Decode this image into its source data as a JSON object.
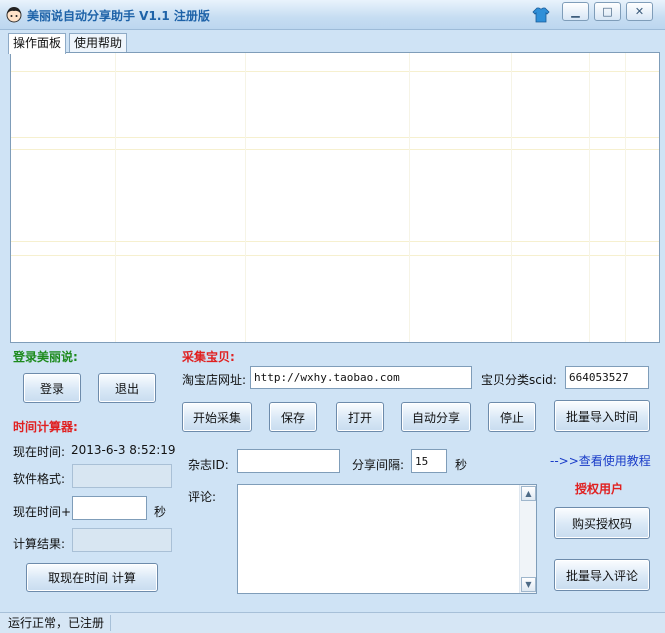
{
  "window": {
    "title": "美丽说自动分享助手 V1.1 注册版",
    "minimize_icon": "minimize-icon",
    "maximize_icon": "maximize-icon",
    "close_icon": "close-icon"
  },
  "tabs": [
    {
      "label": "操作面板"
    },
    {
      "label": "使用帮助"
    }
  ],
  "login": {
    "heading": "登录美丽说:",
    "login_button": "登录",
    "logout_button": "退出"
  },
  "collect": {
    "heading": "采集宝贝:",
    "shop_url_label": "淘宝店网址:",
    "shop_url_value": "http://wxhy.taobao.com",
    "scid_label": "宝贝分类scid:",
    "scid_value": "664053527",
    "buttons": {
      "start": "开始采集",
      "save": "保存",
      "open": "打开",
      "auto_share": "自动分享",
      "stop": "停止",
      "batch_time": "批量导入时间"
    }
  },
  "timer": {
    "heading": "时间计算器:",
    "now_label": "现在时间:",
    "now_value": "2013-6-3 8:52:19",
    "format_label": "软件格式:",
    "now_plus_label": "现在时间+",
    "seconds_unit": "秒",
    "result_label": "计算结果:",
    "calc_button": "取现在时间 计算"
  },
  "share": {
    "magazine_label": "杂志ID:",
    "magazine_value": "",
    "interval_label": "分享间隔:",
    "interval_value": "15",
    "interval_unit": "秒",
    "comment_label": "评论:",
    "tutorial_link": "-->>查看使用教程",
    "authorized_text": "授权用户",
    "buy_button": "购买授权码",
    "batch_comment_button": "批量导入评论"
  },
  "status": {
    "text": "运行正常，已注册"
  },
  "colors": {
    "background": "#cfe3f5",
    "green_heading": "#1c8a1c",
    "red_heading": "#e02020",
    "link": "#1a3cc8"
  }
}
